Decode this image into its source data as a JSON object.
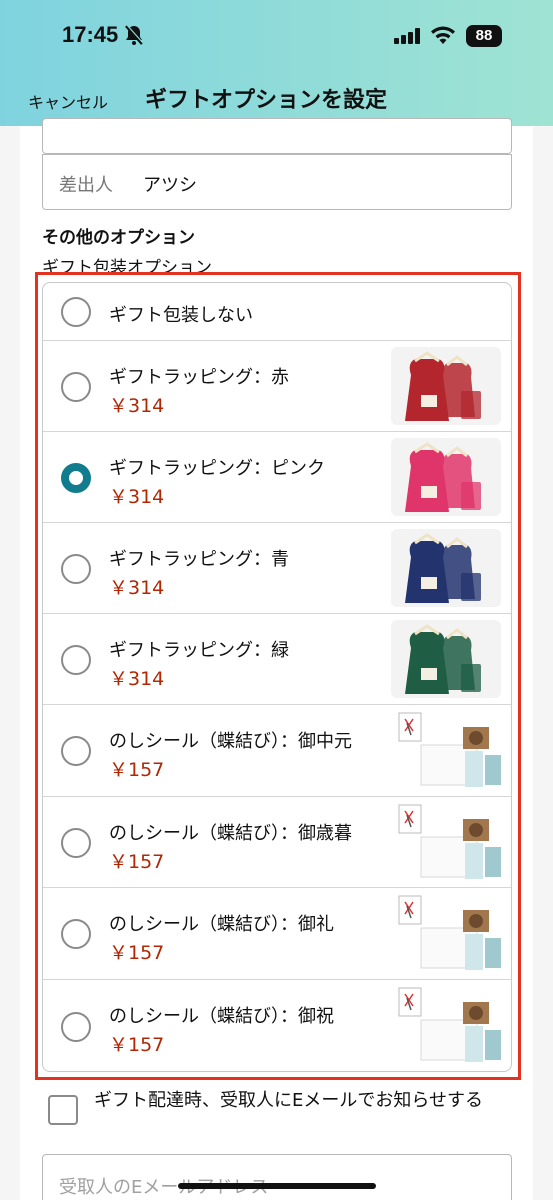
{
  "status": {
    "time": "17:45",
    "battery": "88"
  },
  "nav": {
    "cancel": "キャンセル",
    "title": "ギフトオプションを設定"
  },
  "sender": {
    "label": "差出人",
    "value": "アツシ"
  },
  "other_options": {
    "title": "その他のオプション",
    "subtitle": "ギフト包装オプション"
  },
  "options": [
    {
      "label": "ギフト包装しない",
      "price": "",
      "selected": false,
      "thumb": "none"
    },
    {
      "label": "ギフトラッピング：赤",
      "price": "￥314",
      "selected": false,
      "thumb": "gift-bag",
      "color": "#b3262d"
    },
    {
      "label": "ギフトラッピング：ピンク",
      "price": "￥314",
      "selected": true,
      "thumb": "gift-bag",
      "color": "#e0356b"
    },
    {
      "label": "ギフトラッピング：青",
      "price": "￥314",
      "selected": false,
      "thumb": "gift-bag",
      "color": "#23336e"
    },
    {
      "label": "ギフトラッピング：緑",
      "price": "￥314",
      "selected": false,
      "thumb": "gift-bag",
      "color": "#1f5e45"
    },
    {
      "label": "のしシール（蝶結び）：御中元",
      "price": "￥157",
      "selected": false,
      "thumb": "noshi"
    },
    {
      "label": "のしシール（蝶結び）：御歳暮",
      "price": "￥157",
      "selected": false,
      "thumb": "noshi"
    },
    {
      "label": "のしシール（蝶結び）：御礼",
      "price": "￥157",
      "selected": false,
      "thumb": "noshi"
    },
    {
      "label": "のしシール（蝶結び）：御祝",
      "price": "￥157",
      "selected": false,
      "thumb": "noshi"
    }
  ],
  "notify": {
    "label": "ギフト配達時、受取人にEメールでお知らせする",
    "checked": false
  },
  "email": {
    "placeholder": "受取人のEメールアドレス"
  },
  "colors": {
    "accent": "#127c8f",
    "price": "#b12704",
    "highlight": "#e3321f"
  }
}
